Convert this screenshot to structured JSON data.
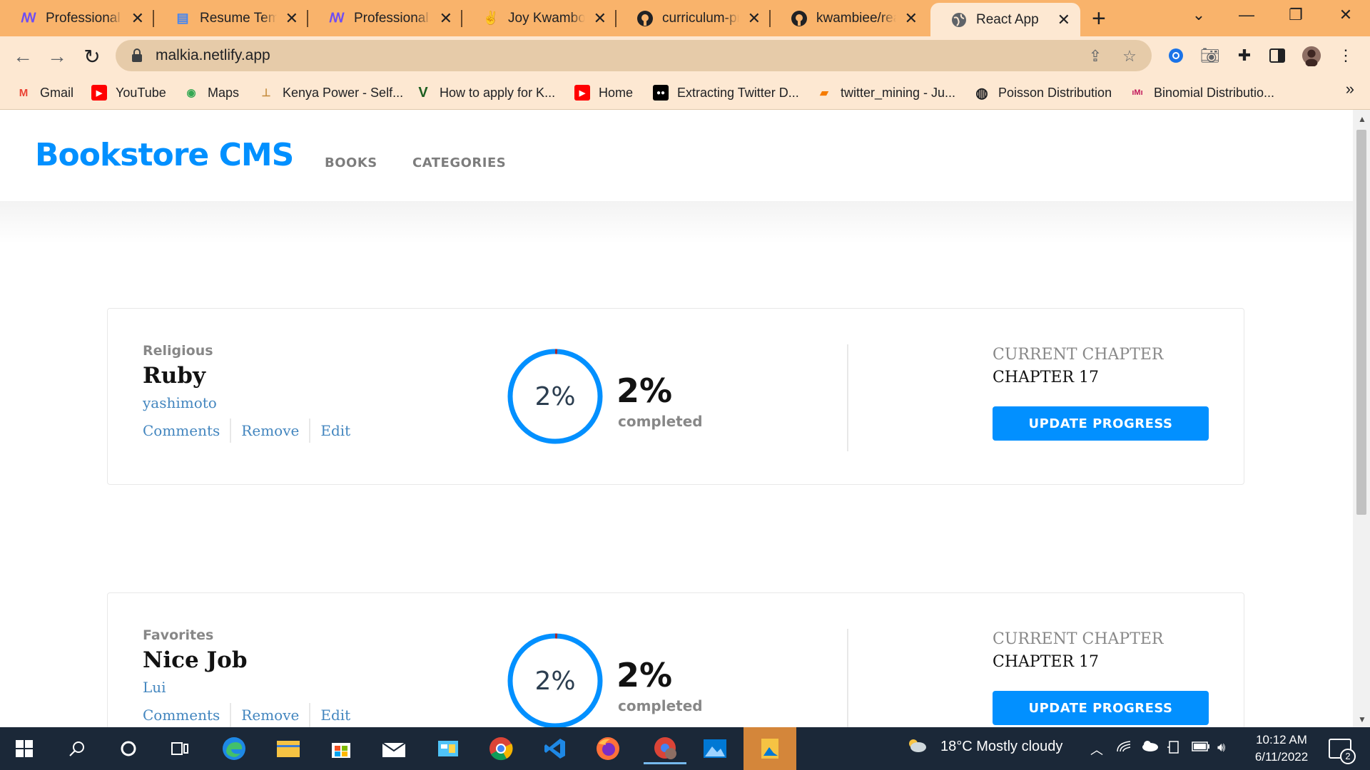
{
  "browser": {
    "tabs": [
      {
        "title": "Professional Sk",
        "icon": "microverse-icon",
        "color": "#6f4ef2"
      },
      {
        "title": "Resume Templ",
        "icon": "docs-icon",
        "color": "#4285f4"
      },
      {
        "title": "Professional Sk",
        "icon": "microverse-icon",
        "color": "#6f4ef2"
      },
      {
        "title": "Joy Kwamboka",
        "icon": "peace-hand-icon",
        "color": "#202124"
      },
      {
        "title": "curriculum-pro",
        "icon": "github-icon",
        "color": "#202124"
      },
      {
        "title": "kwambiee/reac",
        "icon": "github-icon",
        "color": "#202124"
      },
      {
        "title": "React App",
        "icon": "globe-icon",
        "color": "#5f6368"
      }
    ],
    "url": "malkia.netlify.app",
    "bookmarks": [
      {
        "label": "Gmail",
        "icon": "gmail-icon",
        "color": "#ea4335",
        "glyph": "M"
      },
      {
        "label": "YouTube",
        "icon": "youtube-icon",
        "color": "#ff0000",
        "glyph": "▶"
      },
      {
        "label": "Maps",
        "icon": "maps-icon",
        "color": "#34a853",
        "glyph": "◉"
      },
      {
        "label": "Kenya Power - Self...",
        "icon": "kenya-power-icon",
        "color": "#c48a3a",
        "glyph": "⊥"
      },
      {
        "label": "How to apply for K...",
        "icon": "v-icon",
        "color": "#1b5e20",
        "glyph": "V"
      },
      {
        "label": "Home",
        "icon": "youtube-icon",
        "color": "#ff0000",
        "glyph": "▶"
      },
      {
        "label": "Extracting Twitter D...",
        "icon": "medium-icon",
        "color": "#000000",
        "glyph": "●●"
      },
      {
        "label": "twitter_mining - Ju...",
        "icon": "notebook-icon",
        "color": "#f57c00",
        "glyph": "▰"
      },
      {
        "label": "Poisson Distribution",
        "icon": "globe-icon",
        "color": "#202124",
        "glyph": "◍"
      },
      {
        "label": "Binomial Distributio...",
        "icon": "mm-icon",
        "color": "#c2185b",
        "glyph": "M"
      }
    ],
    "bookmarks_more": "»"
  },
  "app": {
    "brand": "Bookstore CMS",
    "nav": {
      "books": "BOOKS",
      "categories": "CATEGORIES"
    },
    "action_labels": {
      "comments": "Comments",
      "remove": "Remove",
      "edit": "Edit"
    },
    "current_chapter_label": "CURRENT CHAPTER",
    "update_button": "UPDATE PROGRESS",
    "completed_label": "completed",
    "accent_color": "#0290ff",
    "books": [
      {
        "genre": "Religious",
        "title": "Ruby",
        "author": "yashimoto",
        "progress_percent": 2,
        "progress_text": "2%",
        "chapter": "CHAPTER 17"
      },
      {
        "genre": "Favorites",
        "title": "Nice Job",
        "author": "Lui",
        "progress_percent": 2,
        "progress_text": "2%",
        "chapter": "CHAPTER 17"
      }
    ]
  },
  "taskbar": {
    "weather": "18°C  Mostly cloudy",
    "time": "10:12 AM",
    "date": "6/11/2022",
    "notifications": "2"
  }
}
